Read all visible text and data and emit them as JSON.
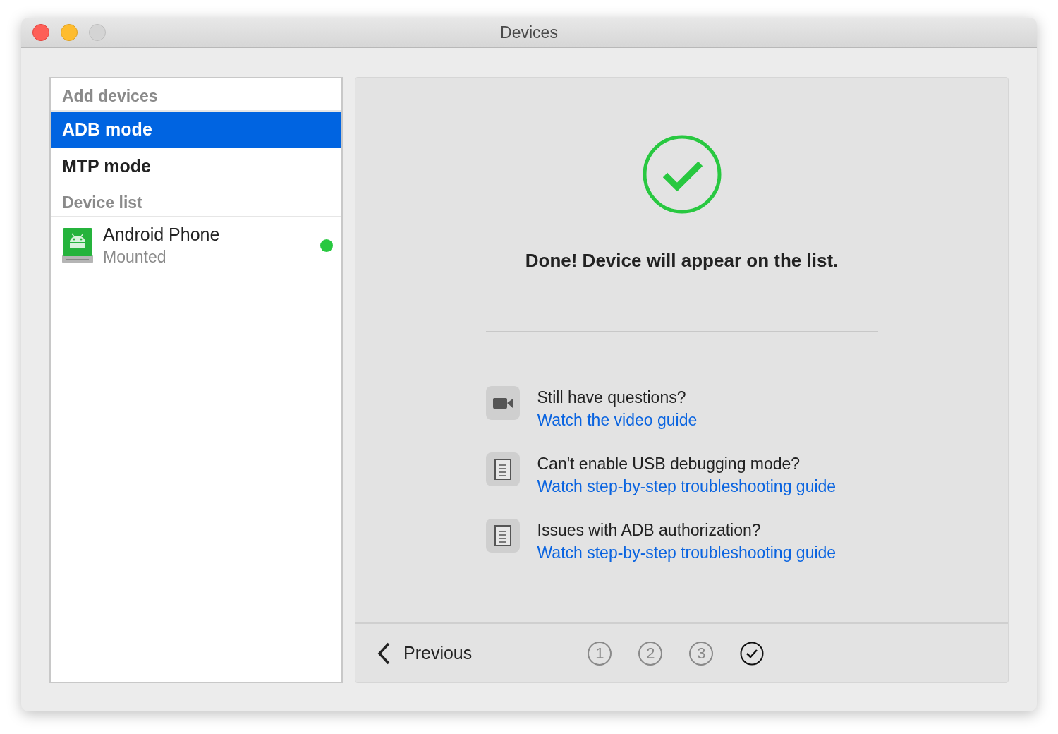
{
  "window": {
    "title": "Devices"
  },
  "sidebar": {
    "sections": [
      {
        "heading": "Add devices",
        "items": [
          {
            "label": "ADB mode",
            "selected": true
          },
          {
            "label": "MTP mode",
            "selected": false
          }
        ]
      },
      {
        "heading": "Device list",
        "devices": [
          {
            "name": "Android Phone",
            "status": "Mounted",
            "color": "#28c840"
          }
        ]
      }
    ]
  },
  "main": {
    "message": "Done! Device will appear on the list.",
    "help": [
      {
        "kind": "video",
        "question": "Still have questions?",
        "link": "Watch the video guide"
      },
      {
        "kind": "document",
        "question": "Can't enable USB debugging mode?",
        "link": "Watch step-by-step troubleshooting guide"
      },
      {
        "kind": "document",
        "question": "Issues with ADB authorization?",
        "link": "Watch step-by-step troubleshooting guide"
      }
    ],
    "footer": {
      "previous": "Previous",
      "steps": [
        {
          "kind": "number",
          "label": "1",
          "selected": false
        },
        {
          "kind": "number",
          "label": "2",
          "selected": false
        },
        {
          "kind": "number",
          "label": "3",
          "selected": false
        },
        {
          "kind": "done",
          "selected": true
        }
      ]
    }
  }
}
